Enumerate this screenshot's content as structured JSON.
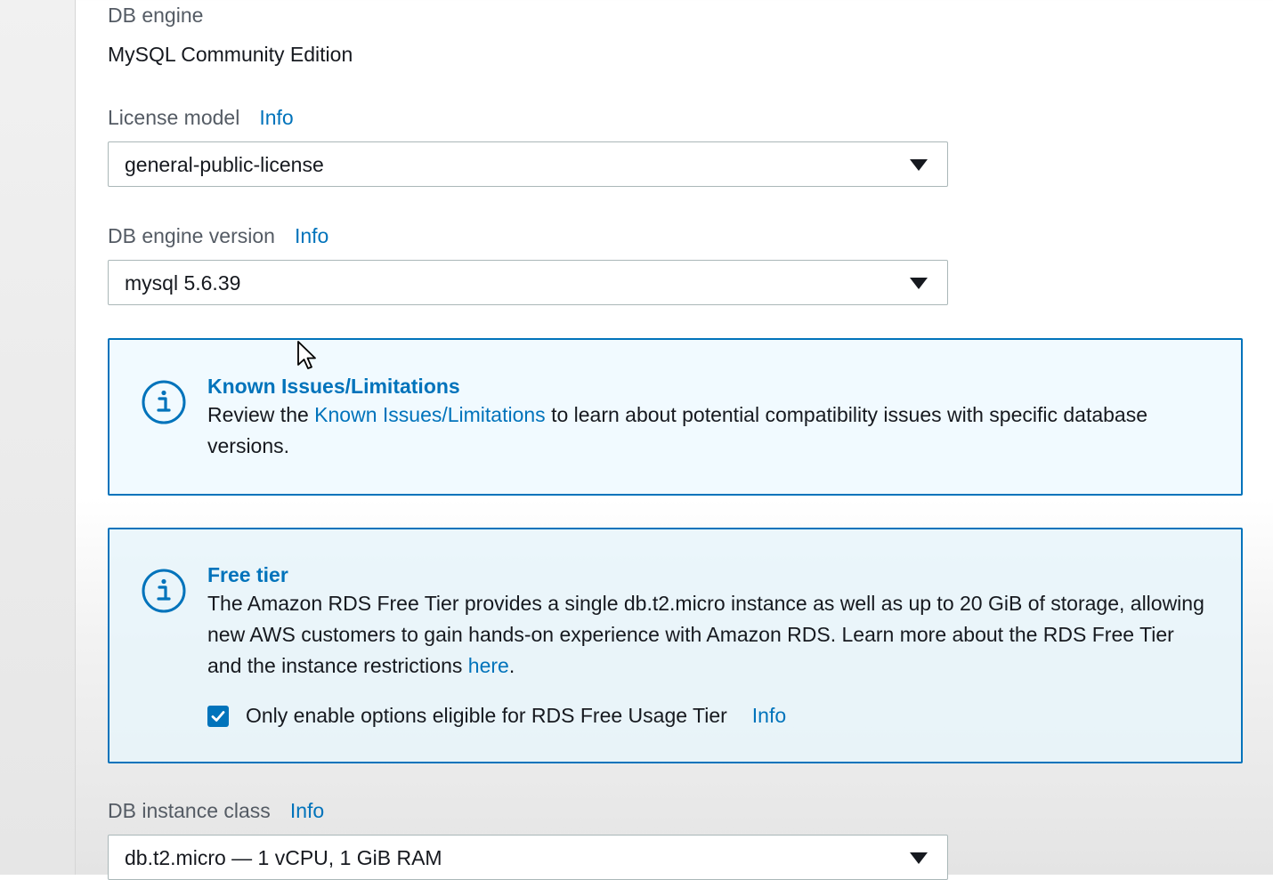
{
  "db_engine": {
    "label": "DB engine",
    "value": "MySQL Community Edition"
  },
  "license_model": {
    "label": "License model",
    "info": "Info",
    "selected": "general-public-license"
  },
  "engine_version": {
    "label": "DB engine version",
    "info": "Info",
    "selected": "mysql 5.6.39"
  },
  "known_issues": {
    "title": "Known Issues/Limitations",
    "text_before": "Review the ",
    "link": "Known Issues/Limitations",
    "text_after": " to learn about potential compatibility issues with specific database versions."
  },
  "free_tier": {
    "title": "Free tier",
    "text": "The Amazon RDS Free Tier provides a single db.t2.micro instance as well as up to 20 GiB of storage, allowing new AWS customers to gain hands-on experience with Amazon RDS. Learn more about the RDS Free Tier and the instance restrictions ",
    "link": "here",
    "text_end": ".",
    "checkbox_label": "Only enable options eligible for RDS Free Usage Tier",
    "checkbox_checked": true,
    "info": "Info"
  },
  "instance_class": {
    "label": "DB instance class",
    "info": "Info",
    "selected": "db.t2.micro — 1 vCPU, 1 GiB RAM"
  },
  "colors": {
    "accent": "#0073bb",
    "label": "#545b64",
    "text": "#16191f"
  }
}
